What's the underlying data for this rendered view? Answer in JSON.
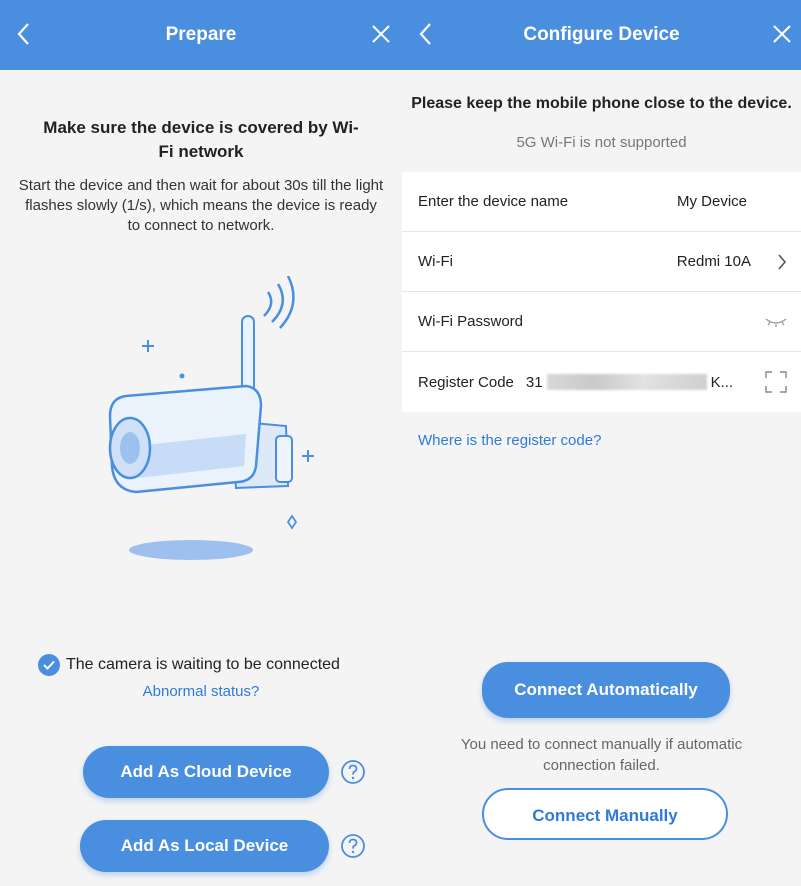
{
  "left": {
    "title": "Prepare",
    "heading": "Make sure the device is covered by Wi-Fi network",
    "description": "Start the device and then wait for about 30s till the light flashes slowly (1/s), which means the device is ready to connect to network.",
    "waiting_text": "The camera is waiting to be connected",
    "abnormal_link": "Abnormal status?",
    "cloud_button": "Add As Cloud Device",
    "local_button": "Add As Local Device"
  },
  "right": {
    "title": "Configure Device",
    "heading": "Please keep the mobile phone close to the device.",
    "subheading": "5G Wi-Fi is not supported",
    "fields": {
      "device_name_label": "Enter the device name",
      "device_name_value": "My Device",
      "wifi_label": "Wi-Fi",
      "wifi_value": "Redmi 10A",
      "password_label": "Wi-Fi Password",
      "register_label": "Register Code",
      "register_prefix": "31",
      "register_suffix": "K..."
    },
    "register_help_link": "Where is the register code?",
    "auto_button": "Connect Automatically",
    "info_text": "You need to connect manually if automatic connection failed.",
    "manual_button": "Connect Manually"
  },
  "colors": {
    "primary": "#4a8fdf",
    "link": "#2f7bd8",
    "background": "#f4f4f4"
  }
}
